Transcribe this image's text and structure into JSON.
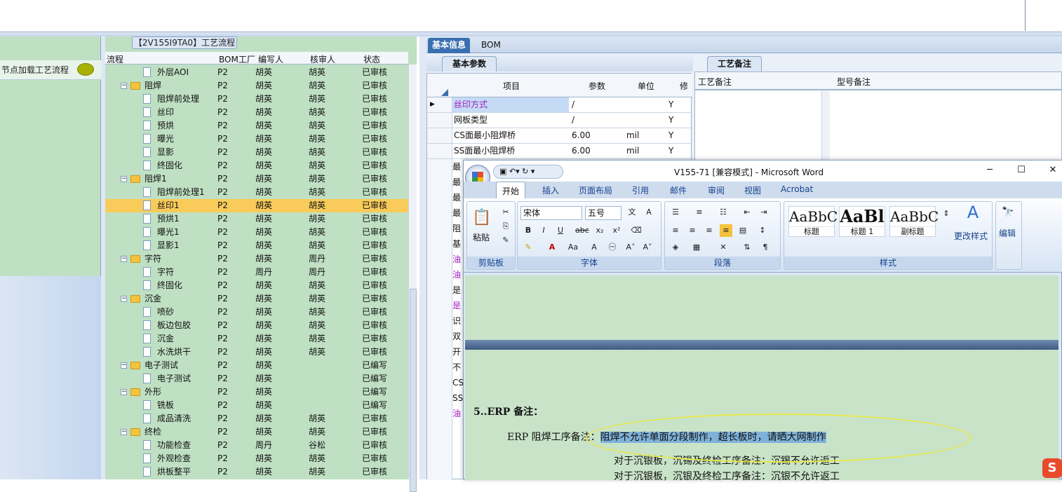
{
  "left": {
    "item": "节点加载工艺流程"
  },
  "tree": {
    "title": "【2V155I9TA0】工艺流程",
    "headers": [
      "流程",
      "BOM工厂",
      "编写人",
      "核审人",
      "状态"
    ],
    "rows": [
      {
        "name": "外层AOI",
        "f": "P2",
        "w": "胡英",
        "r": "胡英",
        "s": "已审核",
        "lvl": 2
      },
      {
        "name": "阻焊",
        "f": "P2",
        "w": "胡英",
        "r": "胡英",
        "s": "已审核",
        "lvl": 1
      },
      {
        "name": "阻焊前处理",
        "f": "P2",
        "w": "胡英",
        "r": "胡英",
        "s": "已审核",
        "lvl": 2
      },
      {
        "name": "丝印",
        "f": "P2",
        "w": "胡英",
        "r": "胡英",
        "s": "已审核",
        "lvl": 2
      },
      {
        "name": "预烘",
        "f": "P2",
        "w": "胡英",
        "r": "胡英",
        "s": "已审核",
        "lvl": 2
      },
      {
        "name": "曝光",
        "f": "P2",
        "w": "胡英",
        "r": "胡英",
        "s": "已审核",
        "lvl": 2
      },
      {
        "name": "显影",
        "f": "P2",
        "w": "胡英",
        "r": "胡英",
        "s": "已审核",
        "lvl": 2
      },
      {
        "name": "终固化",
        "f": "P2",
        "w": "胡英",
        "r": "胡英",
        "s": "已审核",
        "lvl": 2
      },
      {
        "name": "阻焊1",
        "f": "P2",
        "w": "胡英",
        "r": "胡英",
        "s": "已审核",
        "lvl": 1
      },
      {
        "name": "阻焊前处理1",
        "f": "P2",
        "w": "胡英",
        "r": "胡英",
        "s": "已审核",
        "lvl": 2
      },
      {
        "name": "丝印1",
        "f": "P2",
        "w": "胡英",
        "r": "胡英",
        "s": "已审核",
        "lvl": 2,
        "sel": true
      },
      {
        "name": "预烘1",
        "f": "P2",
        "w": "胡英",
        "r": "胡英",
        "s": "已审核",
        "lvl": 2
      },
      {
        "name": "曝光1",
        "f": "P2",
        "w": "胡英",
        "r": "胡英",
        "s": "已审核",
        "lvl": 2
      },
      {
        "name": "显影1",
        "f": "P2",
        "w": "胡英",
        "r": "胡英",
        "s": "已审核",
        "lvl": 2
      },
      {
        "name": "字符",
        "f": "P2",
        "w": "胡英",
        "r": "周丹",
        "s": "已审核",
        "lvl": 1
      },
      {
        "name": "字符",
        "f": "P2",
        "w": "周丹",
        "r": "周丹",
        "s": "已审核",
        "lvl": 2
      },
      {
        "name": "终固化",
        "f": "P2",
        "w": "胡英",
        "r": "胡英",
        "s": "已审核",
        "lvl": 2
      },
      {
        "name": "沉金",
        "f": "P2",
        "w": "胡英",
        "r": "胡英",
        "s": "已审核",
        "lvl": 1
      },
      {
        "name": "喷砂",
        "f": "P2",
        "w": "胡英",
        "r": "胡英",
        "s": "已审核",
        "lvl": 2
      },
      {
        "name": "板边包胶",
        "f": "P2",
        "w": "胡英",
        "r": "胡英",
        "s": "已审核",
        "lvl": 2
      },
      {
        "name": "沉金",
        "f": "P2",
        "w": "胡英",
        "r": "胡英",
        "s": "已审核",
        "lvl": 2
      },
      {
        "name": "水洗烘干",
        "f": "P2",
        "w": "胡英",
        "r": "胡英",
        "s": "已审核",
        "lvl": 2
      },
      {
        "name": "电子测试",
        "f": "P2",
        "w": "胡英",
        "r": "",
        "s": "已编写",
        "lvl": 1
      },
      {
        "name": "电子测试",
        "f": "P2",
        "w": "胡英",
        "r": "",
        "s": "已编写",
        "lvl": 2
      },
      {
        "name": "外形",
        "f": "P2",
        "w": "胡英",
        "r": "",
        "s": "已编写",
        "lvl": 1
      },
      {
        "name": "铣板",
        "f": "P2",
        "w": "胡英",
        "r": "",
        "s": "已编写",
        "lvl": 2
      },
      {
        "name": "成品清洗",
        "f": "P2",
        "w": "胡英",
        "r": "胡英",
        "s": "已审核",
        "lvl": 2
      },
      {
        "name": "终检",
        "f": "P2",
        "w": "胡英",
        "r": "胡英",
        "s": "已审核",
        "lvl": 1
      },
      {
        "name": "功能检查",
        "f": "P2",
        "w": "周丹",
        "r": "谷松",
        "s": "已审核",
        "lvl": 2
      },
      {
        "name": "外观检查",
        "f": "P2",
        "w": "胡英",
        "r": "胡英",
        "s": "已审核",
        "lvl": 2
      },
      {
        "name": "烘板整平",
        "f": "P2",
        "w": "胡英",
        "r": "胡英",
        "s": "已审核",
        "lvl": 2
      }
    ]
  },
  "right": {
    "tabs": [
      "基本信息",
      "BOM"
    ],
    "basic_tab": "基本参数",
    "memo_tab": "工艺备注",
    "grid_headers": [
      "项目",
      "参数",
      "单位",
      "修"
    ],
    "grid_rows": [
      {
        "item": "丝印方式",
        "param": "/",
        "unit": "",
        "mod": "Y"
      },
      {
        "item": "网板类型",
        "param": "/",
        "unit": "",
        "mod": "Y"
      },
      {
        "item": "CS面最小阻焊桥",
        "param": "6.00",
        "unit": "mil",
        "mod": "Y"
      },
      {
        "item": "SS面最小阻焊桥",
        "param": "6.00",
        "unit": "mil",
        "mod": "Y"
      }
    ],
    "lower_letters": [
      "最",
      "最",
      "最",
      "最",
      "阻",
      "基",
      "油",
      "油",
      "是",
      "是",
      "识",
      "双",
      "开",
      "不",
      "CS",
      "SS",
      "油"
    ],
    "memo_headers": [
      "工艺备注",
      "型号备注"
    ]
  },
  "word": {
    "title": "V155-71 [兼容模式] - Microsoft Word",
    "tabs": [
      "开始",
      "插入",
      "页面布局",
      "引用",
      "邮件",
      "审阅",
      "视图",
      "Acrobat"
    ],
    "font_name": "宋体",
    "font_size": "五号",
    "groups": [
      "剪贴板",
      "字体",
      "段落",
      "样式"
    ],
    "paste_label": "粘贴",
    "styles": [
      {
        "sample": "AaBbC",
        "label": "标题"
      },
      {
        "sample": "AaBl",
        "label": "标题 1"
      },
      {
        "sample": "AaBbC",
        "label": "副标题"
      }
    ],
    "change_style": "更改样式",
    "edit": "编辑",
    "doc": {
      "heading": "5..ERP 备注：",
      "line1_prefix": "ERP 阻焊工序备注：",
      "line1_highlight": "阻焊不允许单面分段制作，超长板时，请晒大网制作",
      "line2": "对于沉银板，沉锡及终检工序备注：沉锡不允许返工",
      "line3": "对于沉银板，沉银及终检工序备注：沉银不允许返工"
    }
  }
}
